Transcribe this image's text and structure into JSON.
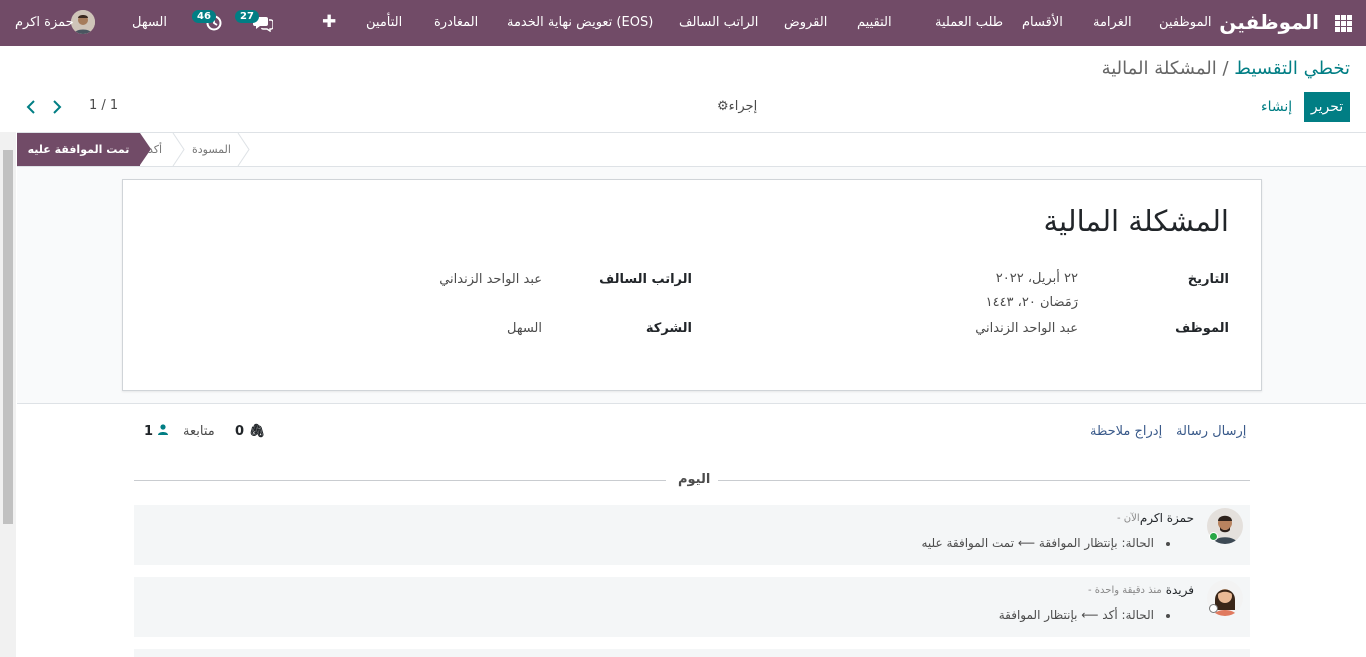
{
  "nav": {
    "brand": "الموظفين",
    "menu": [
      "الموظفين",
      "الغرامة",
      "الأقسام",
      "طلب العملية",
      "التقييم",
      "القروض",
      "الراتب السالف",
      "تعويض نهاية الخدمة (EOS)",
      "المغادرة",
      "التأمين"
    ],
    "activities_count": "46",
    "messages_count": "27",
    "company": "السهل",
    "user": "حمزة اكرم"
  },
  "control": {
    "breadcrumb_parent": "تخطي التقسيط",
    "breadcrumb_sep": "/",
    "breadcrumb_current": "المشكلة المالية",
    "edit_label": "تحرير",
    "create_label": "إنشاء",
    "action_label": "إجراء",
    "pager": "1 / 1"
  },
  "status": {
    "active": "تمت الموافقة عليه",
    "stages": [
      "أكد",
      "المسودة"
    ]
  },
  "form": {
    "title": "المشكلة المالية",
    "date_label": "التاريخ",
    "date_value": "٢٢ أبريل، ٢٠٢٢",
    "date_hijri": "رَمَضان ٢٠، ١٤٤٣",
    "employee_label": "الموظف",
    "employee_value": "عبد الواحد الزنداني",
    "advance_label": "الراتب السالف",
    "advance_value": "عبد الواحد الزنداني",
    "company_label": "الشركة",
    "company_value": "السهل"
  },
  "chatter": {
    "send_message": "إرسال رسالة",
    "log_note": "إدراج ملاحظة",
    "attachments": "0",
    "follow": "متابعة",
    "followers": "1",
    "today": "اليوم",
    "messages": [
      {
        "author": "حمزة اكرم",
        "time": "- الآن",
        "change": "الحالة: بإنتظار الموافقة ⟵ تمت الموافقة عليه"
      },
      {
        "author": "فريدة",
        "time": "- منذ دقيقة واحدة",
        "change": "الحالة: أكد ⟵ بإنتظار الموافقة"
      }
    ]
  },
  "colors": {
    "brand": "#714b67",
    "accent": "#017e84"
  }
}
